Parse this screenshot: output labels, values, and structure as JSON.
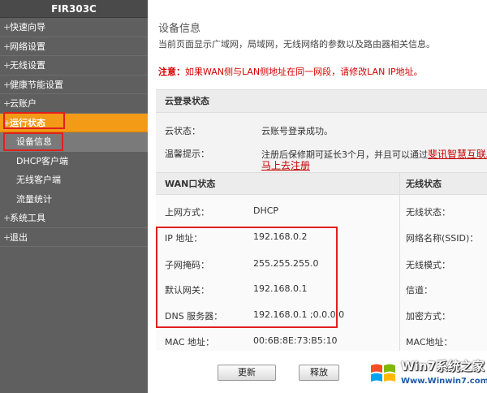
{
  "sidebar": {
    "brand": "FIR303C",
    "items": [
      {
        "label": "快速向导",
        "prefix": "+"
      },
      {
        "label": "网络设置",
        "prefix": "+"
      },
      {
        "label": "无线设置",
        "prefix": "+"
      },
      {
        "label": "健康节能设置",
        "prefix": "+"
      },
      {
        "label": "云账户",
        "prefix": "+"
      },
      {
        "label": "运行状态",
        "prefix": "+"
      }
    ],
    "subitems": [
      {
        "label": "设备信息"
      },
      {
        "label": "DHCP客户端"
      },
      {
        "label": "无线客户端"
      },
      {
        "label": "流量统计"
      }
    ],
    "items_after": [
      {
        "label": "系统工具",
        "prefix": "+"
      },
      {
        "label": "退出",
        "prefix": "+"
      }
    ]
  },
  "main": {
    "title": "设备信息",
    "description": "当前页面显示广域网，局域网，无线网络的参数以及路由器相关信息。",
    "notice_prefix": "注意：",
    "notice_text": "如果WAN侧与LAN侧地址在同一网段，请修改LAN IP地址。",
    "cloud": {
      "header": "云登录状态",
      "status_label": "云状态：",
      "status_value": "云账号登录成功。",
      "tip_label": "温馨提示：",
      "tip_value": "注册后保修期可延长3个月，并且可以通过",
      "tip_link": "斐讯智慧互联A",
      "register_link": "马上去注册"
    },
    "wan": {
      "header": "WAN口状态",
      "rows": [
        {
          "label": "上网方式：",
          "value": "DHCP"
        },
        {
          "label": "IP 地址：",
          "value": "192.168.0.2"
        },
        {
          "label": "子网掩码：",
          "value": "255.255.255.0"
        },
        {
          "label": "默认网关：",
          "value": "192.168.0.1"
        },
        {
          "label": "DNS 服务器：",
          "value": "192.168.0.1 ;0.0.0.0"
        },
        {
          "label": "MAC 地址：",
          "value": "00:6B:8E:73:B5:10"
        }
      ]
    },
    "wireless": {
      "header": "无线状态",
      "rows": [
        {
          "label": "无线状态："
        },
        {
          "label": "网络名称(SSID)："
        },
        {
          "label": "无线模式："
        },
        {
          "label": "信道："
        },
        {
          "label": "加密方式："
        },
        {
          "label": "MAC地址："
        }
      ]
    },
    "buttons": {
      "refresh": "更新",
      "release": "释放"
    }
  },
  "watermark": {
    "title": "Win7系统之家",
    "url": "Www.Winwin7.com"
  }
}
